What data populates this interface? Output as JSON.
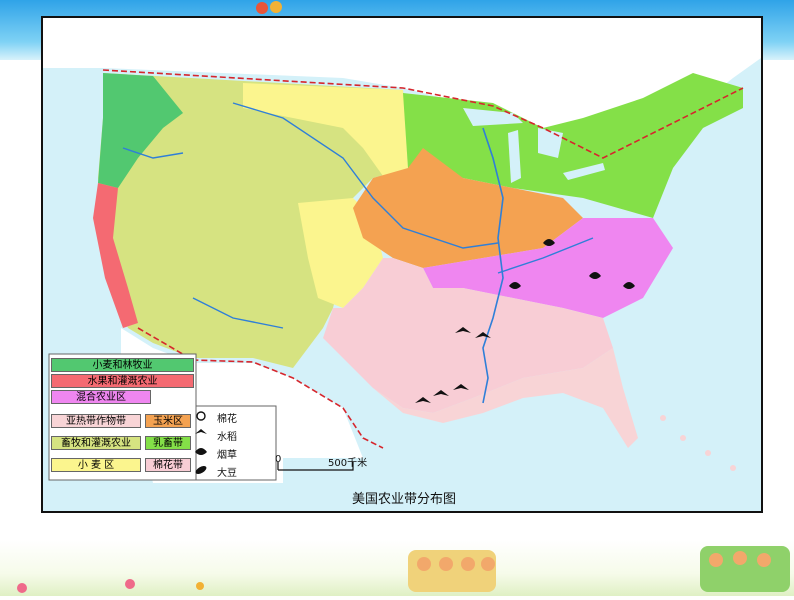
{
  "map": {
    "title": "美国农业带分布图",
    "legend": {
      "wheat_forestry": "小麦和林牧业",
      "fruit_irrigation": "水果和灌溉农业",
      "mixed_farming": "混合农业区",
      "subtropical": "亚热带作物带",
      "corn_belt": "玉米区",
      "ranching_irrigation": "畜牧和灌溉农业",
      "dairy_belt": "乳畜带",
      "wheat_belt": "小 麦 区",
      "cotton_belt": "棉花带"
    },
    "crops": {
      "cotton": "棉花",
      "rice": "水稻",
      "tobacco": "烟草",
      "soybean": "大豆"
    },
    "scale": {
      "zero": "0",
      "distance": "500千米"
    }
  },
  "colors": {
    "ocean": "#d4f1f9",
    "wheat_forestry": "#52c870",
    "fruit_irrigation": "#f46a72",
    "mixed_farming": "#ef86f0",
    "subtropical": "#f8d4d6",
    "corn_belt": "#f4a251",
    "ranching_irrigation": "#d6e381",
    "dairy_belt": "#84e048",
    "wheat_belt": "#fbf58e",
    "cotton_belt": "#f8cdd5",
    "river": "#2f7fd8",
    "border": "#d6262d"
  }
}
